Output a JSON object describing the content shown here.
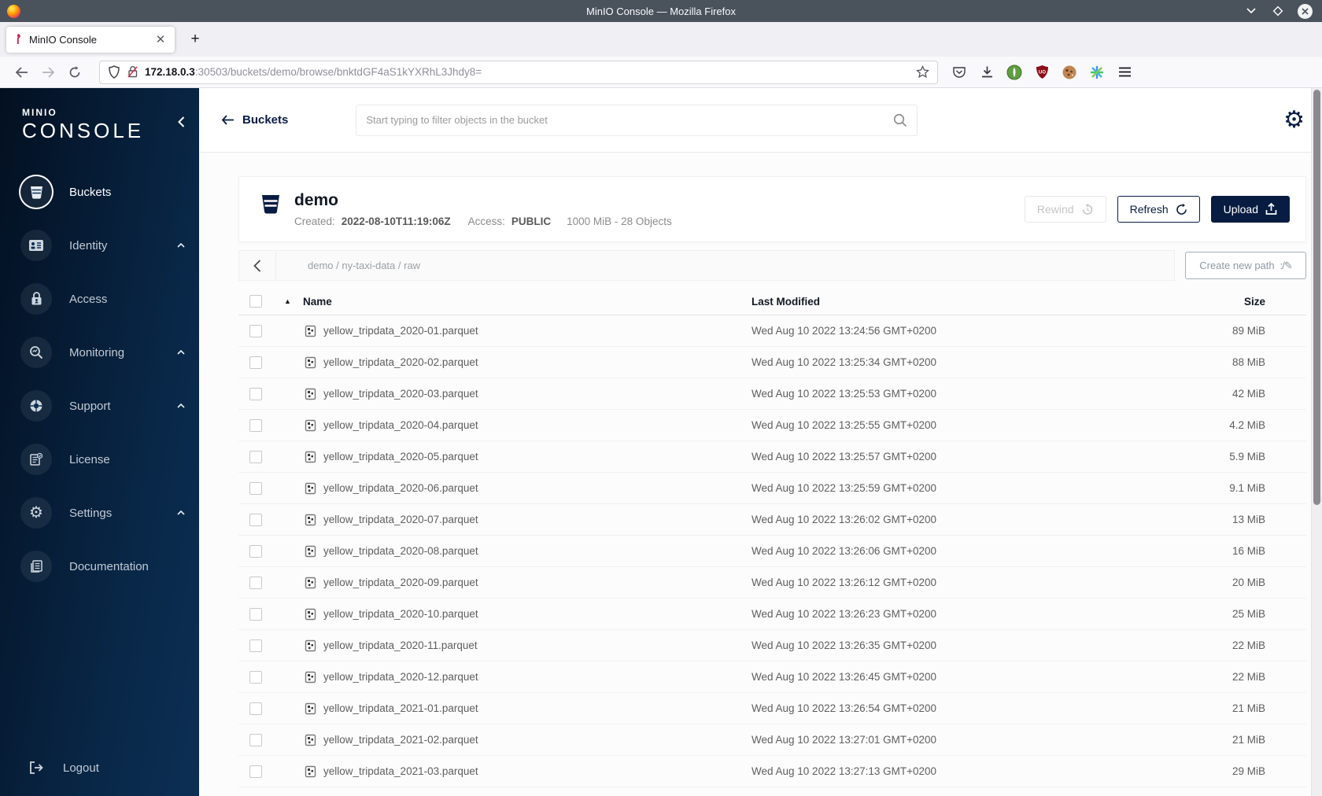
{
  "window": {
    "title": "MinIO Console — Mozilla Firefox"
  },
  "browser": {
    "tab_title": "MinIO Console",
    "new_tab": "+",
    "close_tab": "✕",
    "url_host": "172.18.0.3",
    "url_rest": ":30503/buckets/demo/browse/bnktdGF4aS1kYXRhL3Jhdy8="
  },
  "sidebar": {
    "logo_top": "MINIO",
    "logo_bottom": "CONSOLE",
    "items": {
      "0": {
        "label": "Buckets"
      },
      "1": {
        "label": "Identity"
      },
      "2": {
        "label": "Access"
      },
      "3": {
        "label": "Monitoring"
      },
      "4": {
        "label": "Support"
      },
      "5": {
        "label": "License"
      },
      "6": {
        "label": "Settings"
      },
      "7": {
        "label": "Documentation"
      }
    },
    "logout_label": "Logout",
    "settings_glyph": "⚙"
  },
  "header": {
    "back_label": "Buckets",
    "search_placeholder": "Start typing to filter objects in the bucket",
    "gear_glyph": "⚙"
  },
  "bucket": {
    "name": "demo",
    "created_label": "Created:",
    "created_value": "2022-08-10T11:19:06Z",
    "access_label": "Access:",
    "access_value": "PUBLIC",
    "summary": "1000 MiB - 28 Objects",
    "rewind_label": "Rewind",
    "refresh_label": "Refresh",
    "upload_label": "Upload"
  },
  "browse": {
    "breadcrumb": "demo / ny-taxi-data / raw",
    "create_path_label": "Create new path",
    "create_path_glyph": ":/✎",
    "columns": {
      "name": "Name",
      "modified": "Last Modified",
      "size": "Size"
    },
    "sort_glyph": "▲",
    "rows": [
      {
        "name": "yellow_tripdata_2020-01.parquet",
        "modified": "Wed Aug 10 2022 13:24:56 GMT+0200",
        "size": "89 MiB"
      },
      {
        "name": "yellow_tripdata_2020-02.parquet",
        "modified": "Wed Aug 10 2022 13:25:34 GMT+0200",
        "size": "88 MiB"
      },
      {
        "name": "yellow_tripdata_2020-03.parquet",
        "modified": "Wed Aug 10 2022 13:25:53 GMT+0200",
        "size": "42 MiB"
      },
      {
        "name": "yellow_tripdata_2020-04.parquet",
        "modified": "Wed Aug 10 2022 13:25:55 GMT+0200",
        "size": "4.2 MiB"
      },
      {
        "name": "yellow_tripdata_2020-05.parquet",
        "modified": "Wed Aug 10 2022 13:25:57 GMT+0200",
        "size": "5.9 MiB"
      },
      {
        "name": "yellow_tripdata_2020-06.parquet",
        "modified": "Wed Aug 10 2022 13:25:59 GMT+0200",
        "size": "9.1 MiB"
      },
      {
        "name": "yellow_tripdata_2020-07.parquet",
        "modified": "Wed Aug 10 2022 13:26:02 GMT+0200",
        "size": "13 MiB"
      },
      {
        "name": "yellow_tripdata_2020-08.parquet",
        "modified": "Wed Aug 10 2022 13:26:06 GMT+0200",
        "size": "16 MiB"
      },
      {
        "name": "yellow_tripdata_2020-09.parquet",
        "modified": "Wed Aug 10 2022 13:26:12 GMT+0200",
        "size": "20 MiB"
      },
      {
        "name": "yellow_tripdata_2020-10.parquet",
        "modified": "Wed Aug 10 2022 13:26:23 GMT+0200",
        "size": "25 MiB"
      },
      {
        "name": "yellow_tripdata_2020-11.parquet",
        "modified": "Wed Aug 10 2022 13:26:35 GMT+0200",
        "size": "22 MiB"
      },
      {
        "name": "yellow_tripdata_2020-12.parquet",
        "modified": "Wed Aug 10 2022 13:26:45 GMT+0200",
        "size": "22 MiB"
      },
      {
        "name": "yellow_tripdata_2021-01.parquet",
        "modified": "Wed Aug 10 2022 13:26:54 GMT+0200",
        "size": "21 MiB"
      },
      {
        "name": "yellow_tripdata_2021-02.parquet",
        "modified": "Wed Aug 10 2022 13:27:01 GMT+0200",
        "size": "21 MiB"
      },
      {
        "name": "yellow_tripdata_2021-03.parquet",
        "modified": "Wed Aug 10 2022 13:27:13 GMT+0200",
        "size": "29 MiB"
      }
    ]
  },
  "colors": {
    "brand_navy": "#081c42",
    "sidebar_gradient_start": "#031021",
    "sidebar_gradient_end": "#0c2f54",
    "titlebar": "#4a525c"
  }
}
